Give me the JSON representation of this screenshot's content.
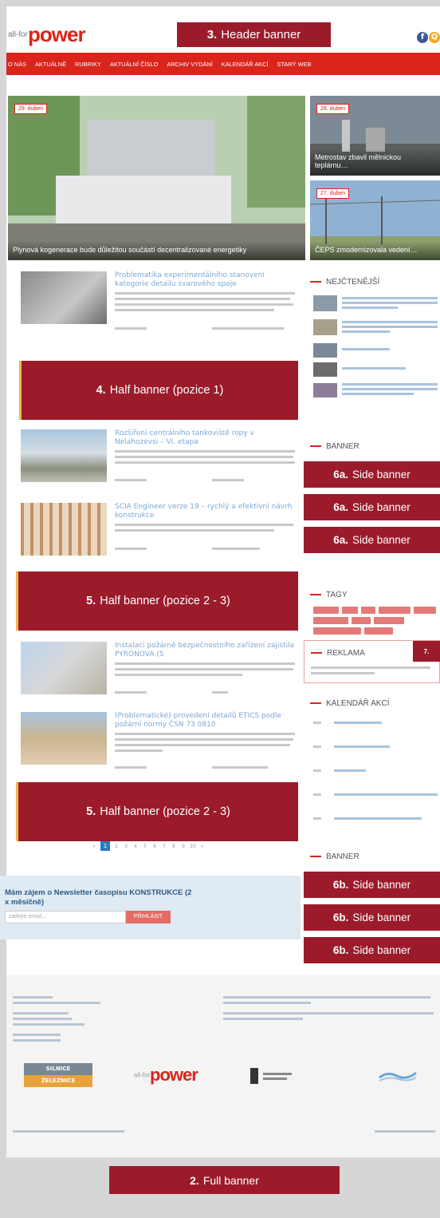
{
  "header": {
    "logo_small": "all-for",
    "logo_big": "power",
    "banner_label_num": "3.",
    "banner_label_text": "Header banner",
    "social_fb": "f",
    "social_search": "Q"
  },
  "nav": {
    "items": [
      "O NÁS",
      "AKTUÁLNĚ",
      "RUBRIKY",
      "AKTUÁLNÍ ČÍSLO",
      "ARCHIV VYDÁNÍ",
      "KALENDÁŘ AKCÍ",
      "STARÝ WEB"
    ]
  },
  "hero": {
    "main": {
      "date": "29. duben",
      "caption": "Plynová kogenerace bude důležitou součástí decentralizované energetiky"
    },
    "side1": {
      "date": "28. duben",
      "caption": "Metrostav zbavil mělnickou teplárnu…"
    },
    "side2": {
      "date": "27. duben",
      "caption": "ČEPS zmodernizovala vedení…"
    }
  },
  "articles": [
    {
      "title": "Problematika experimentálního stanovení kategorie detailu svarového spoje"
    },
    {
      "title": "Rozšíření centrálního tankoviště ropy v Nelahozevsi – VI. etapa"
    },
    {
      "title": "SCIA Engineer verze 19 – rychlý a efektivní návrh konstrukce"
    },
    {
      "title": "Instalaci požárně bezpečnostního zařízení zajistila PYRONOVA (S"
    },
    {
      "title": "(Problematické) provedení detailů ETICS podle požární normy ČSN 73 0810"
    }
  ],
  "banners": {
    "half1": {
      "num": "4.",
      "text": "Half banner (pozice 1)"
    },
    "half2": {
      "num": "5.",
      "text": "Half banner (pozice 2 - 3)"
    },
    "half3": {
      "num": "5.",
      "text": "Half banner (pozice 2 - 3)"
    },
    "side_a": {
      "num": "6a.",
      "text": "Side banner"
    },
    "side_b": {
      "num": "6b.",
      "text": "Side banner"
    },
    "reklama_num": "7.",
    "full": {
      "num": "2.",
      "text": "Full banner"
    }
  },
  "sidebar": {
    "nejctenejsi": "NEJČTENĚJŠÍ",
    "banner1": "BANNER",
    "tagy": "TAGY",
    "reklama": "REKLAMA",
    "kalendar": "KALENDÁŘ AKCÍ",
    "banner2": "BANNER"
  },
  "pager": {
    "pages": [
      "«",
      "1",
      "2",
      "3",
      "4",
      "5",
      "6",
      "7",
      "8",
      "9",
      "10",
      "»"
    ],
    "current": "1"
  },
  "newsletter": {
    "title": "Mám zájem o Newsletter časopisu KONSTRUKCE (2 x měsíčně)",
    "placeholder": "zadejte email...",
    "button": "PŘIHLÁSIT"
  },
  "footer": {
    "logo_silnice_1": "SILNICE",
    "logo_silnice_2": "ŽELEZNICE",
    "logo_power_small": "all-for",
    "logo_power_big": "power"
  },
  "colors": {
    "brand_red": "#d9251c",
    "banner": "#9b1b2b",
    "link": "#7da7d4"
  }
}
